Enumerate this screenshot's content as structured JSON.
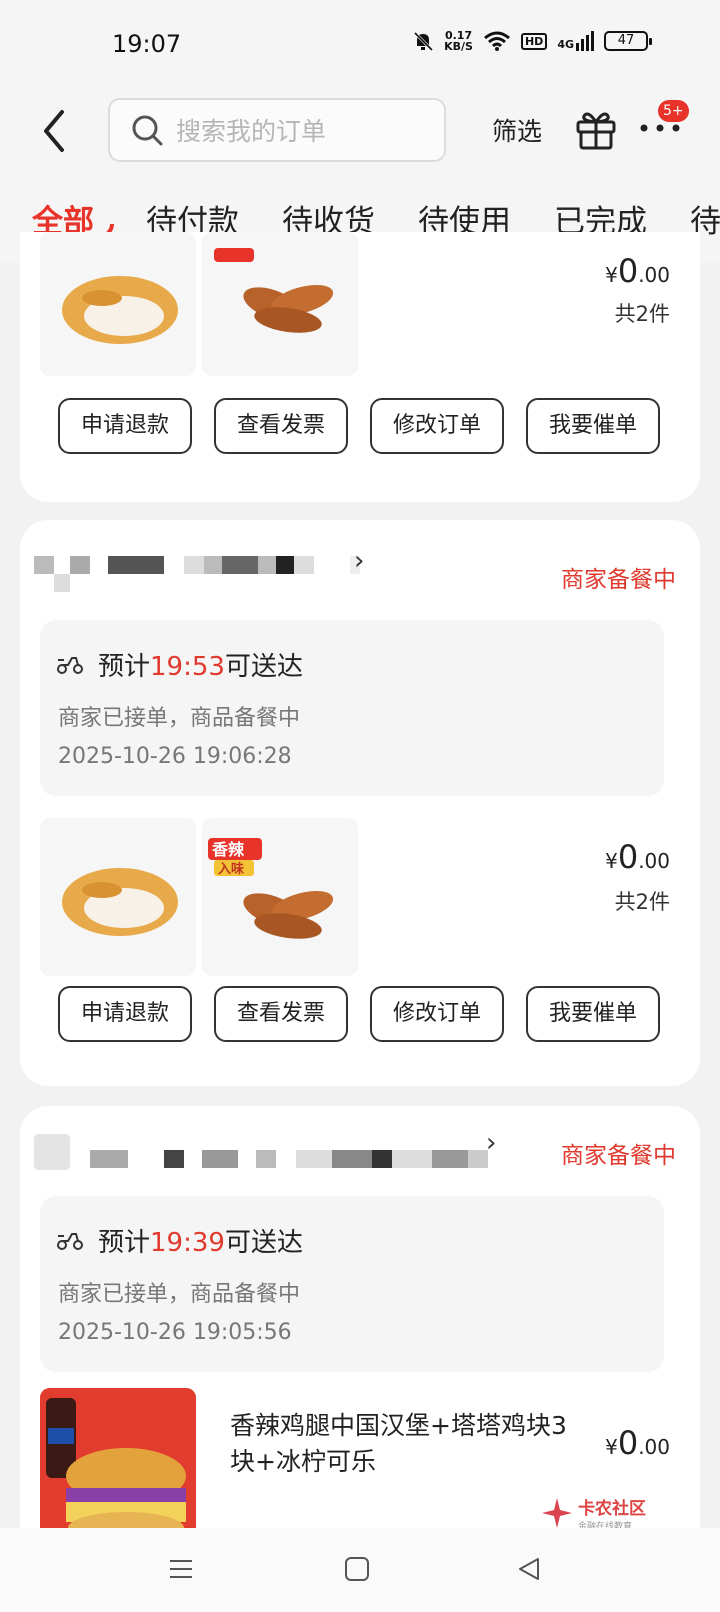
{
  "status_bar": {
    "time": "19:07",
    "net_speed_value": "0.17",
    "net_speed_unit": "KB/S",
    "hd_label": "HD",
    "signal_label": "4G",
    "battery": "47"
  },
  "nav": {
    "search_placeholder": "搜索我的订单",
    "filter_label": "筛选",
    "badge": "5+"
  },
  "tabs": [
    {
      "label": "全部",
      "active": true
    },
    {
      "label": "待付款",
      "active": false
    },
    {
      "label": "待收货",
      "active": false
    },
    {
      "label": "待使用",
      "active": false
    },
    {
      "label": "已完成",
      "active": false
    },
    {
      "label": "待",
      "active": false
    }
  ],
  "orders": [
    {
      "price_symbol": "¥",
      "price_int": "0",
      "price_dec": ".00",
      "count": "共2件",
      "actions": [
        "申请退款",
        "查看发票",
        "修改订单",
        "我要催单"
      ]
    },
    {
      "status": "商家备餐中",
      "eta_prefix": "预计",
      "eta_time": "19:53",
      "eta_suffix": "可送达",
      "progress": "商家已接单，商品备餐中",
      "timestamp": "2025-10-26 19:06:28",
      "price_symbol": "¥",
      "price_int": "0",
      "price_dec": ".00",
      "count": "共2件",
      "actions": [
        "申请退款",
        "查看发票",
        "修改订单",
        "我要催单"
      ],
      "thumb_label_1": "香辣",
      "thumb_label_2": "入味"
    },
    {
      "status": "商家备餐中",
      "eta_prefix": "预计",
      "eta_time": "19:39",
      "eta_suffix": "可送达",
      "progress": "商家已接单，商品备餐中",
      "timestamp": "2025-10-26 19:05:56",
      "product_title": "香辣鸡腿中国汉堡+塔塔鸡块3块+冰柠可乐",
      "price_symbol": "¥",
      "price_int": "0",
      "price_dec": ".00"
    }
  ],
  "watermark": {
    "title": "卡农社区",
    "subtitle": "金融在线教育"
  },
  "colors": {
    "accent": "#e8332a",
    "status_red": "#e0392d"
  }
}
